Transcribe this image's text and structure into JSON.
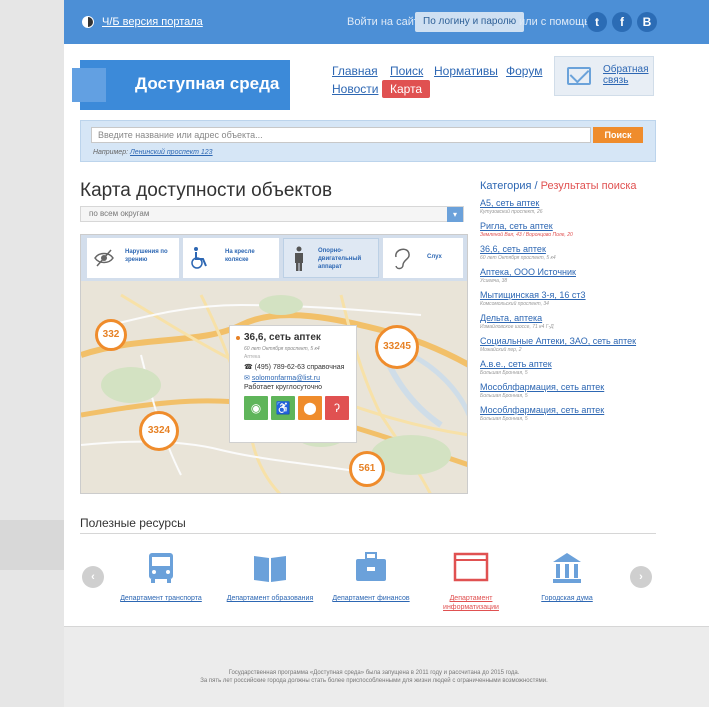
{
  "top": {
    "bw_version": "Ч/Б версия портала",
    "login_text": "Войти на сайт",
    "login_button": "По логину и паролю",
    "or_text": "или с помощью",
    "social": [
      "t",
      "f",
      "B"
    ]
  },
  "brand": {
    "title": "Доступная среда"
  },
  "nav": {
    "main": "Главная",
    "search": "Поиск",
    "norms": "Нормативы",
    "forum": "Форум",
    "news": "Новости",
    "map": "Карта"
  },
  "feedback": {
    "label": "Обратная связь"
  },
  "search": {
    "placeholder": "Введите название или адрес объекта...",
    "button": "Поиск",
    "example_prefix": "Например:",
    "example_link": "Ленинский проспект 123"
  },
  "main": {
    "title": "Карта доступности объектов",
    "district": "по всем округам"
  },
  "filters": [
    {
      "label": "Нарушения по зрению",
      "icon": "eye-icon"
    },
    {
      "label": "На кресле коляске",
      "icon": "wheelchair-icon"
    },
    {
      "label": "Опорно-двигательный аппарат",
      "icon": "person-icon"
    },
    {
      "label": "Слух",
      "icon": "ear-icon"
    }
  ],
  "clusters": [
    "332",
    "33245",
    "3324",
    "561"
  ],
  "popup": {
    "name": "36,6, сеть аптек",
    "address": "60 лет Октября проспект, 5 к4",
    "category": "Аптека",
    "phone": "(495) 789-62-63 справочная",
    "email": "solomonfarma@list.ru",
    "hours": "Работает круглосуточно"
  },
  "results": {
    "category_label": "Категория",
    "results_label": "Результаты поиска",
    "items": [
      {
        "title": "А5, сеть аптек",
        "address": "Кутузовский проспект, 26"
      },
      {
        "title": "Ригла, сеть аптек",
        "address": "Земляной Вал, 43 / Воронцово Поле, 20"
      },
      {
        "title": "36,6, сеть аптек",
        "address": "60 лет Октября проспект, 5 к4"
      },
      {
        "title": "Аптека, ООО Источник",
        "address": "Усиевча, 38"
      },
      {
        "title": "Мытищинская 3-я, 16 ст3",
        "address": "Комсомольский проспект, 34"
      },
      {
        "title": "Дельта, аптека",
        "address": "Измайловское шоссе, 71 к4 Г-Д"
      },
      {
        "title": "Социальные Аптеки, ЗАО, сеть аптек",
        "address": "Можайский пер, 2"
      },
      {
        "title": "А.в.е., сеть аптек",
        "address": "Большая Бронная, 5"
      },
      {
        "title": "Мособлфармация, сеть аптек",
        "address": "Большая Бронная, 5"
      },
      {
        "title": "Мособлфармация, сеть аптек",
        "address": "Большая Бронная, 5"
      }
    ]
  },
  "resources": {
    "title": "Полезные ресурсы",
    "items": [
      {
        "label": "Департамент транспорта",
        "icon": "bus-icon"
      },
      {
        "label": "Департамент образования",
        "icon": "book-icon"
      },
      {
        "label": "Департамент финансов",
        "icon": "briefcase-icon"
      },
      {
        "label": "Департамент информатизации",
        "icon": "browser-icon"
      },
      {
        "label": "Городская дума",
        "icon": "building-icon"
      }
    ]
  },
  "footer": {
    "line1": "Государственная программа «Доступная среда» была запущена в 2011 году и рассчитана до 2015 года.",
    "line2": "За пять лет российские города должны стать более приспособленными для жизни людей с ограниченными возможностями."
  },
  "colors": {
    "primary": "#4c8fd6",
    "accent": "#ef8c2c",
    "active": "#e05151",
    "green": "#5fb55a"
  }
}
